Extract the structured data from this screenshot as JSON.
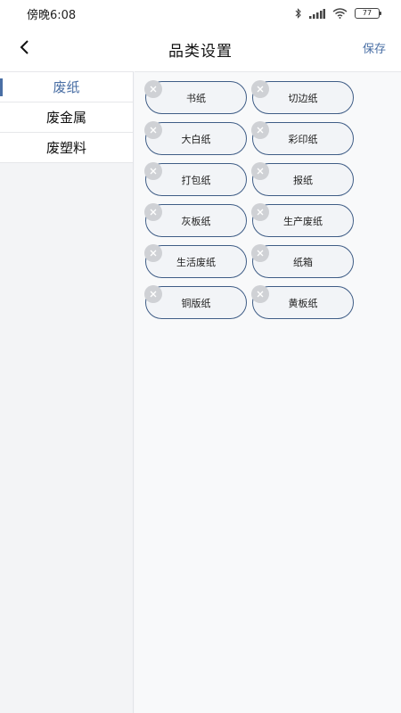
{
  "status_bar": {
    "time": "傍晚6:08",
    "battery": "77"
  },
  "nav": {
    "title": "品类设置",
    "save_label": "保存"
  },
  "sidebar": {
    "items": [
      {
        "label": "废纸",
        "active": true
      },
      {
        "label": "废金属",
        "active": false
      },
      {
        "label": "废塑料",
        "active": false
      }
    ]
  },
  "chips": [
    {
      "label": "书纸"
    },
    {
      "label": "切边纸"
    },
    {
      "label": "大白纸"
    },
    {
      "label": "彩印纸"
    },
    {
      "label": "打包纸"
    },
    {
      "label": "报纸"
    },
    {
      "label": "灰板纸"
    },
    {
      "label": "生产废纸"
    },
    {
      "label": "生活废纸"
    },
    {
      "label": "纸箱"
    },
    {
      "label": "铜版纸"
    },
    {
      "label": "黄板纸"
    }
  ],
  "colors": {
    "accent": "#4a6fa5",
    "chip_border": "#3f5d86",
    "chip_bg": "#f2f4f7",
    "delete_badge": "#cfd1d5"
  }
}
